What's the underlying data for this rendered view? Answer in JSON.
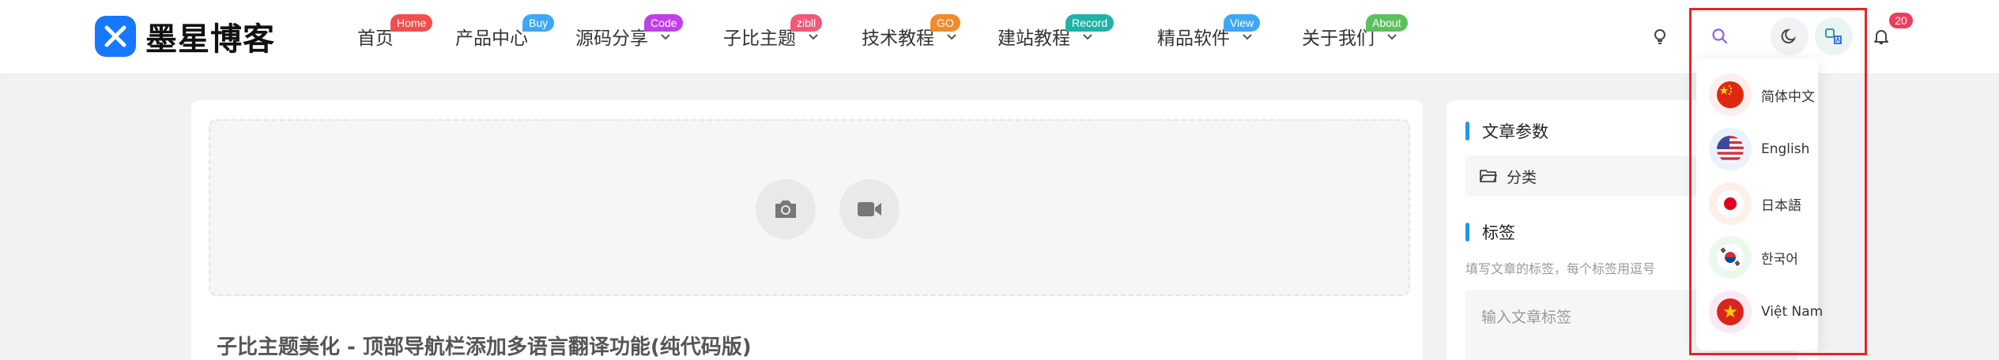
{
  "brand": {
    "name": "墨星博客",
    "accent": "#1677ff"
  },
  "nav": [
    {
      "label": "首页",
      "badge": "Home",
      "badge_color": "#f24e4e",
      "dropdown": false
    },
    {
      "label": "产品中心",
      "badge": "Buy",
      "badge_color": "#3ea7f5",
      "dropdown": false
    },
    {
      "label": "源码分享",
      "badge": "Code",
      "badge_color": "#c040e8",
      "dropdown": true
    },
    {
      "label": "子比主题",
      "badge": "zibll",
      "badge_color": "#f25878",
      "dropdown": true
    },
    {
      "label": "技术教程",
      "badge": "GO",
      "badge_color": "#f08a2b",
      "dropdown": true
    },
    {
      "label": "建站教程",
      "badge": "Record",
      "badge_color": "#1fb3a8",
      "dropdown": true
    },
    {
      "label": "精品软件",
      "badge": "View",
      "badge_color": "#3ea7f5",
      "dropdown": true
    },
    {
      "label": "关于我们",
      "badge": "About",
      "badge_color": "#5cc15c",
      "dropdown": true
    }
  ],
  "header_icons": {
    "notification_count": "20"
  },
  "editor": {
    "title": "子比主题美化 - 顶部导航栏添加多语言翻译功能(纯代码版)"
  },
  "sidebar": {
    "params_title": "文章参数",
    "category_label": "分类",
    "tags_title": "标签",
    "tags_hint": "填写文章的标签，每个标签用逗号",
    "tags_placeholder": "输入文章标签"
  },
  "languages": [
    {
      "label": "简体中文",
      "flag": "cn-flag-icon",
      "bg": "#fdeeee"
    },
    {
      "label": "English",
      "flag": "us-flag-icon",
      "bg": "#eaf2fd"
    },
    {
      "label": "日本語",
      "flag": "jp-flag-icon",
      "bg": "#fdf0ea"
    },
    {
      "label": "한국어",
      "flag": "kr-flag-icon",
      "bg": "#ecf7ee"
    },
    {
      "label": "Việt Nam",
      "flag": "vn-flag-icon",
      "bg": "#fbeaf3"
    }
  ],
  "highlight_color": "#e5252a"
}
